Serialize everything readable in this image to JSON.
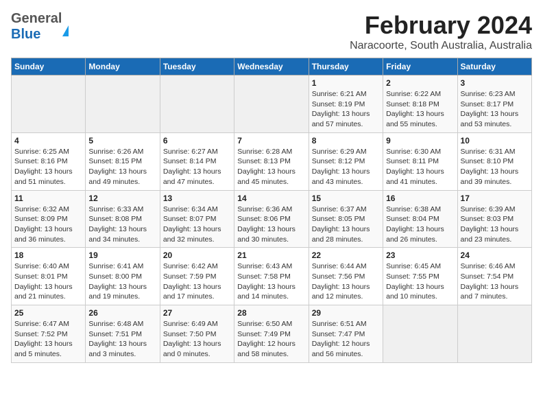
{
  "header": {
    "logo_general": "General",
    "logo_blue": "Blue",
    "title": "February 2024",
    "subtitle": "Naracoorte, South Australia, Australia"
  },
  "days_of_week": [
    "Sunday",
    "Monday",
    "Tuesday",
    "Wednesday",
    "Thursday",
    "Friday",
    "Saturday"
  ],
  "weeks": [
    [
      {
        "day": "",
        "lines": []
      },
      {
        "day": "",
        "lines": []
      },
      {
        "day": "",
        "lines": []
      },
      {
        "day": "",
        "lines": []
      },
      {
        "day": "1",
        "lines": [
          "Sunrise: 6:21 AM",
          "Sunset: 8:19 PM",
          "Daylight: 13 hours",
          "and 57 minutes."
        ]
      },
      {
        "day": "2",
        "lines": [
          "Sunrise: 6:22 AM",
          "Sunset: 8:18 PM",
          "Daylight: 13 hours",
          "and 55 minutes."
        ]
      },
      {
        "day": "3",
        "lines": [
          "Sunrise: 6:23 AM",
          "Sunset: 8:17 PM",
          "Daylight: 13 hours",
          "and 53 minutes."
        ]
      }
    ],
    [
      {
        "day": "4",
        "lines": [
          "Sunrise: 6:25 AM",
          "Sunset: 8:16 PM",
          "Daylight: 13 hours",
          "and 51 minutes."
        ]
      },
      {
        "day": "5",
        "lines": [
          "Sunrise: 6:26 AM",
          "Sunset: 8:15 PM",
          "Daylight: 13 hours",
          "and 49 minutes."
        ]
      },
      {
        "day": "6",
        "lines": [
          "Sunrise: 6:27 AM",
          "Sunset: 8:14 PM",
          "Daylight: 13 hours",
          "and 47 minutes."
        ]
      },
      {
        "day": "7",
        "lines": [
          "Sunrise: 6:28 AM",
          "Sunset: 8:13 PM",
          "Daylight: 13 hours",
          "and 45 minutes."
        ]
      },
      {
        "day": "8",
        "lines": [
          "Sunrise: 6:29 AM",
          "Sunset: 8:12 PM",
          "Daylight: 13 hours",
          "and 43 minutes."
        ]
      },
      {
        "day": "9",
        "lines": [
          "Sunrise: 6:30 AM",
          "Sunset: 8:11 PM",
          "Daylight: 13 hours",
          "and 41 minutes."
        ]
      },
      {
        "day": "10",
        "lines": [
          "Sunrise: 6:31 AM",
          "Sunset: 8:10 PM",
          "Daylight: 13 hours",
          "and 39 minutes."
        ]
      }
    ],
    [
      {
        "day": "11",
        "lines": [
          "Sunrise: 6:32 AM",
          "Sunset: 8:09 PM",
          "Daylight: 13 hours",
          "and 36 minutes."
        ]
      },
      {
        "day": "12",
        "lines": [
          "Sunrise: 6:33 AM",
          "Sunset: 8:08 PM",
          "Daylight: 13 hours",
          "and 34 minutes."
        ]
      },
      {
        "day": "13",
        "lines": [
          "Sunrise: 6:34 AM",
          "Sunset: 8:07 PM",
          "Daylight: 13 hours",
          "and 32 minutes."
        ]
      },
      {
        "day": "14",
        "lines": [
          "Sunrise: 6:36 AM",
          "Sunset: 8:06 PM",
          "Daylight: 13 hours",
          "and 30 minutes."
        ]
      },
      {
        "day": "15",
        "lines": [
          "Sunrise: 6:37 AM",
          "Sunset: 8:05 PM",
          "Daylight: 13 hours",
          "and 28 minutes."
        ]
      },
      {
        "day": "16",
        "lines": [
          "Sunrise: 6:38 AM",
          "Sunset: 8:04 PM",
          "Daylight: 13 hours",
          "and 26 minutes."
        ]
      },
      {
        "day": "17",
        "lines": [
          "Sunrise: 6:39 AM",
          "Sunset: 8:03 PM",
          "Daylight: 13 hours",
          "and 23 minutes."
        ]
      }
    ],
    [
      {
        "day": "18",
        "lines": [
          "Sunrise: 6:40 AM",
          "Sunset: 8:01 PM",
          "Daylight: 13 hours",
          "and 21 minutes."
        ]
      },
      {
        "day": "19",
        "lines": [
          "Sunrise: 6:41 AM",
          "Sunset: 8:00 PM",
          "Daylight: 13 hours",
          "and 19 minutes."
        ]
      },
      {
        "day": "20",
        "lines": [
          "Sunrise: 6:42 AM",
          "Sunset: 7:59 PM",
          "Daylight: 13 hours",
          "and 17 minutes."
        ]
      },
      {
        "day": "21",
        "lines": [
          "Sunrise: 6:43 AM",
          "Sunset: 7:58 PM",
          "Daylight: 13 hours",
          "and 14 minutes."
        ]
      },
      {
        "day": "22",
        "lines": [
          "Sunrise: 6:44 AM",
          "Sunset: 7:56 PM",
          "Daylight: 13 hours",
          "and 12 minutes."
        ]
      },
      {
        "day": "23",
        "lines": [
          "Sunrise: 6:45 AM",
          "Sunset: 7:55 PM",
          "Daylight: 13 hours",
          "and 10 minutes."
        ]
      },
      {
        "day": "24",
        "lines": [
          "Sunrise: 6:46 AM",
          "Sunset: 7:54 PM",
          "Daylight: 13 hours",
          "and 7 minutes."
        ]
      }
    ],
    [
      {
        "day": "25",
        "lines": [
          "Sunrise: 6:47 AM",
          "Sunset: 7:52 PM",
          "Daylight: 13 hours",
          "and 5 minutes."
        ]
      },
      {
        "day": "26",
        "lines": [
          "Sunrise: 6:48 AM",
          "Sunset: 7:51 PM",
          "Daylight: 13 hours",
          "and 3 minutes."
        ]
      },
      {
        "day": "27",
        "lines": [
          "Sunrise: 6:49 AM",
          "Sunset: 7:50 PM",
          "Daylight: 13 hours",
          "and 0 minutes."
        ]
      },
      {
        "day": "28",
        "lines": [
          "Sunrise: 6:50 AM",
          "Sunset: 7:49 PM",
          "Daylight: 12 hours",
          "and 58 minutes."
        ]
      },
      {
        "day": "29",
        "lines": [
          "Sunrise: 6:51 AM",
          "Sunset: 7:47 PM",
          "Daylight: 12 hours",
          "and 56 minutes."
        ]
      },
      {
        "day": "",
        "lines": []
      },
      {
        "day": "",
        "lines": []
      }
    ]
  ]
}
